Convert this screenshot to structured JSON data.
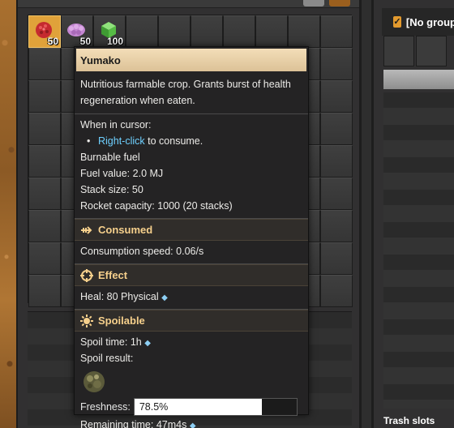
{
  "inventory": {
    "items": [
      {
        "name": "yumako",
        "icon": "yumako-icon",
        "count": "50",
        "color": "#d63a3a"
      },
      {
        "name": "jellynut",
        "icon": "jellynut-icon",
        "count": "50",
        "color": "#c98fd6"
      },
      {
        "name": "green-block",
        "icon": "green-block-icon",
        "count": "100",
        "color": "#54c247"
      }
    ]
  },
  "logistics": {
    "header_label": "[No group",
    "trash_label": "Trash slots"
  },
  "tooltip": {
    "title": "Yumako",
    "description": "Nutritious farmable crop. Grants burst of health regeneration when eaten.",
    "cursor_heading": "When in cursor:",
    "cursor_action_key": "Right-click",
    "cursor_action_text": "to consume.",
    "burnable": "Burnable fuel",
    "fuel_value_label": "Fuel value:",
    "fuel_value": "2.0 MJ",
    "stack_size_label": "Stack size:",
    "stack_size": "50",
    "rocket_capacity_label": "Rocket capacity:",
    "rocket_capacity": "1000 (20 stacks)",
    "consumed": {
      "heading": "Consumed",
      "speed_label": "Consumption speed:",
      "speed_value": "0.06/s"
    },
    "effect": {
      "heading": "Effect",
      "heal_label": "Heal:",
      "heal_value": "80 Physical"
    },
    "spoilable": {
      "heading": "Spoilable",
      "spoil_time_label": "Spoil time:",
      "spoil_time": "1h",
      "spoil_result_label": "Spoil result:",
      "spoil_result_icon": "spoilage-icon",
      "freshness_label": "Freshness:",
      "freshness_text": "78.5%",
      "freshness_fraction": 0.785,
      "remaining_label": "Remaining time:",
      "remaining_value": "47m4s"
    }
  }
}
